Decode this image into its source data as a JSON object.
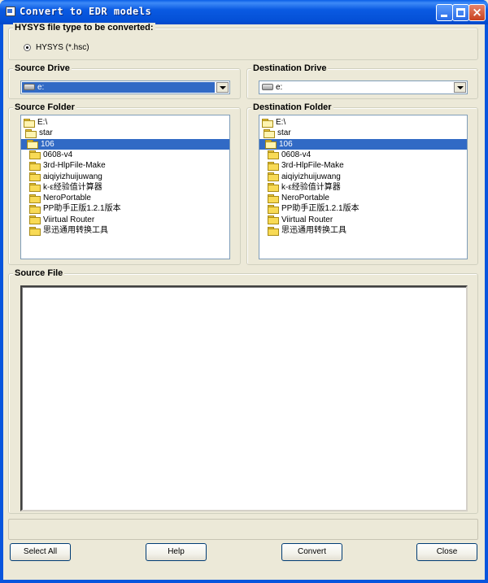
{
  "window": {
    "title": "Convert to EDR models",
    "controls": {
      "minimize": "minimize-icon",
      "maximize": "maximize-icon",
      "close": "×"
    }
  },
  "file_type": {
    "legend": "HYSYS file type to be converted:",
    "option_label": "HYSYS  (*.hsc)",
    "selected": true
  },
  "source_drive": {
    "legend": "Source Drive",
    "value": "e:"
  },
  "destination_drive": {
    "legend": "Destination Drive",
    "value": "e:"
  },
  "source_folder": {
    "legend": "Source Folder",
    "items": [
      {
        "label": "E:\\",
        "open": true,
        "indent": 0
      },
      {
        "label": "star",
        "open": true,
        "indent": 1
      },
      {
        "label": "106",
        "open": true,
        "indent": 2,
        "selected": true
      },
      {
        "label": "0608-v4",
        "indent": 3
      },
      {
        "label": "3rd-HlpFile-Make",
        "indent": 3
      },
      {
        "label": "aiqiyizhuijuwang",
        "indent": 3
      },
      {
        "label": "k-ε经验值计算器",
        "indent": 3
      },
      {
        "label": "NeroPortable",
        "indent": 3
      },
      {
        "label": "PP助手正版1.2.1版本",
        "indent": 3
      },
      {
        "label": "Viirtual Router",
        "indent": 3
      },
      {
        "label": "思迅通用转换工具",
        "indent": 3
      }
    ]
  },
  "destination_folder": {
    "legend": "Destination Folder",
    "items": [
      {
        "label": "E:\\",
        "open": true,
        "indent": 0
      },
      {
        "label": "star",
        "open": true,
        "indent": 1
      },
      {
        "label": "106",
        "open": true,
        "indent": 2,
        "selected": true
      },
      {
        "label": "0608-v4",
        "indent": 3
      },
      {
        "label": "3rd-HlpFile-Make",
        "indent": 3
      },
      {
        "label": "aiqiyizhuijuwang",
        "indent": 3
      },
      {
        "label": "k-ε经验值计算器",
        "indent": 3
      },
      {
        "label": "NeroPortable",
        "indent": 3
      },
      {
        "label": "PP助手正版1.2.1版本",
        "indent": 3
      },
      {
        "label": "Viirtual Router",
        "indent": 3
      },
      {
        "label": "思迅通用转换工具",
        "indent": 3
      }
    ]
  },
  "source_file": {
    "legend": "Source File",
    "items": []
  },
  "buttons": {
    "select_all": "Select All",
    "help": "Help",
    "convert": "Convert",
    "close": "Close"
  },
  "colors": {
    "selection": "#316ac5",
    "dialog_bg": "#ece9d8",
    "titlebar": "#0a5ae2"
  }
}
